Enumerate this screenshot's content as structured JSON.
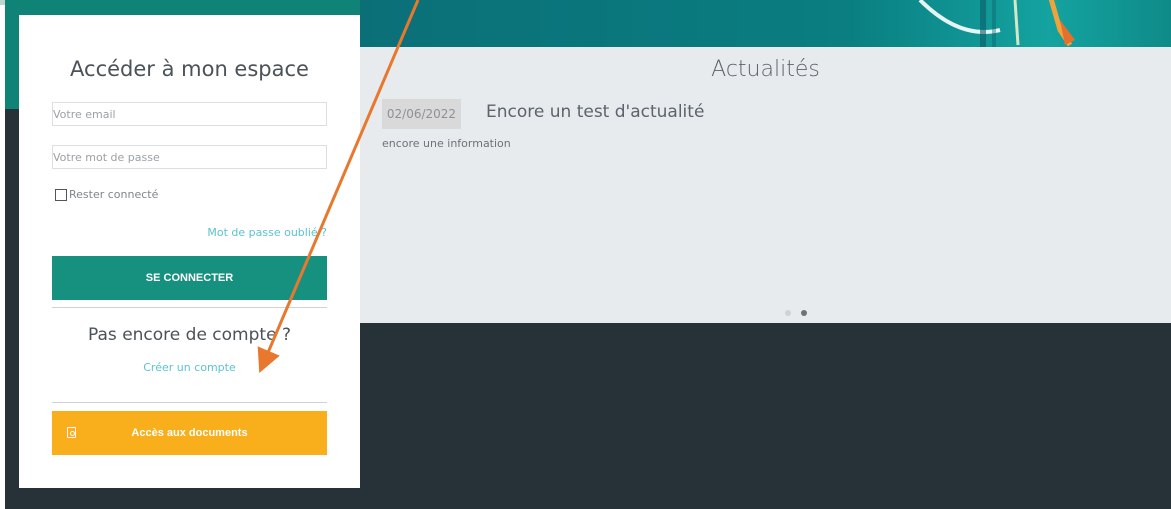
{
  "login": {
    "title": "Accéder à mon espace",
    "email_placeholder": "Votre email",
    "password_placeholder": "Votre mot de passe",
    "remember_label": "Rester connecté",
    "forgot_link": "Mot de passe oublié ?",
    "login_button": "SE CONNECTER",
    "no_account_title": "Pas encore de compte ?",
    "create_account_link": "Créer un compte",
    "documents_button": "Accès aux documents"
  },
  "news": {
    "title": "Actualités",
    "items": [
      {
        "date": "02/06/2022",
        "headline": "Encore un test d'actualité",
        "body": "encore une information"
      }
    ],
    "carousel": {
      "pages": 2,
      "active_page": 2
    }
  },
  "colors": {
    "primary": "#16907f",
    "accent": "#f9ae1b",
    "link": "#5bc3cf",
    "dark_bg": "#263238",
    "annotation_arrow": "#e8782d"
  },
  "icons": {
    "documents": "pdf-file-icon"
  }
}
